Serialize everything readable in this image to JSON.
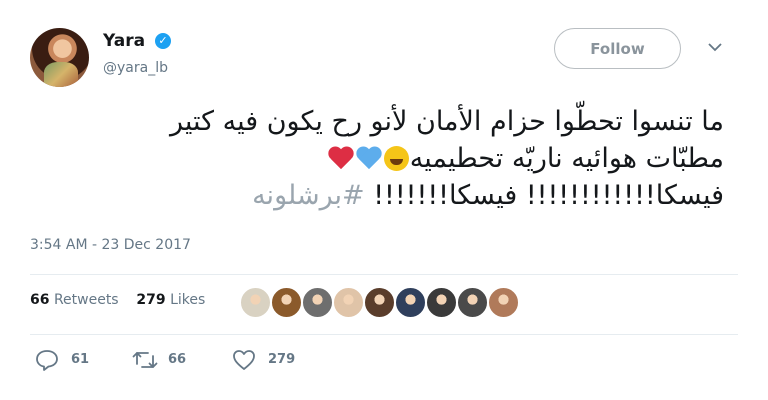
{
  "user": {
    "name": "Yara",
    "handle": "@yara_lb",
    "verified_mark": "✓"
  },
  "header": {
    "follow_label": "Follow"
  },
  "tweet": {
    "line1": "ما تنسوا تحطّوا حزام الأمان لأنو رح يكون فيه كتير",
    "line2_text": "مطبّات هوائيه ناريّه تحطيميه",
    "line3_text": "فيسكا!!!!!!!!!!!! فيسكا!!!!!!! ",
    "hashtag": "#برشلونه",
    "timestamp": "3:54 AM - 23 Dec 2017"
  },
  "stats": {
    "retweets_count": "66",
    "retweets_label": "Retweets",
    "likes_count": "279",
    "likes_label": "Likes"
  },
  "likers_colors": [
    "#d9d2c2",
    "#8b5a2b",
    "#6e6e6e",
    "#e0c4a8",
    "#5a3d2b",
    "#2f3f5c",
    "#3a3a3a",
    "#4a4a4a",
    "#b07a5a"
  ],
  "actions": {
    "reply_count": "61",
    "retweet_count": "66",
    "like_count": "279"
  },
  "colors": {
    "verified": "#1da1f2",
    "muted": "#657786",
    "text": "#14171a"
  }
}
